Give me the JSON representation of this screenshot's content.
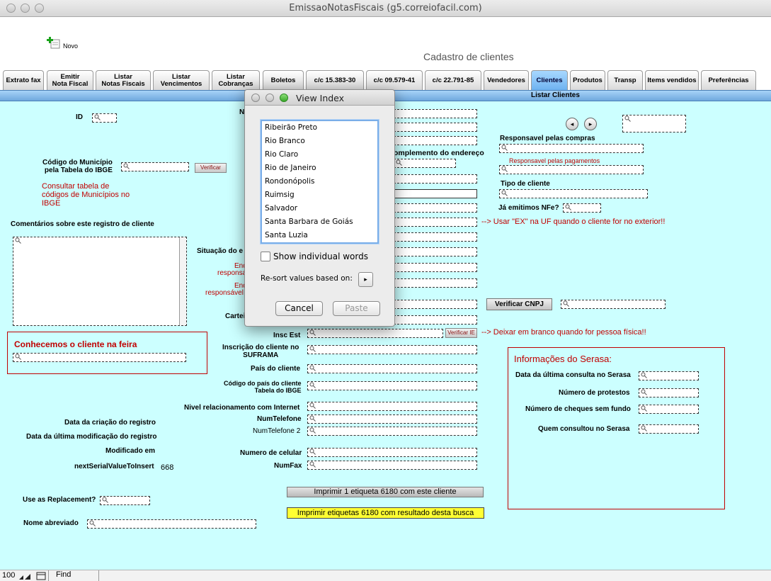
{
  "window": {
    "title": "EmissaoNotasFiscais (g5.correiofacil.com)"
  },
  "toolbar": {
    "new_label": "Novo",
    "page_heading": "Cadastro de clientes"
  },
  "tabs": [
    {
      "label": "Extrato fax"
    },
    {
      "label": "Emitir\nNota Fiscal"
    },
    {
      "label": "Listar\nNotas Fiscais"
    },
    {
      "label": "Listar\nVencimentos"
    },
    {
      "label": "Listar\nCobranças"
    },
    {
      "label": "Boletos"
    },
    {
      "label": "c/c 15.383-30"
    },
    {
      "label": "c/c 09.579-41"
    },
    {
      "label": "c/c 22.791-85"
    },
    {
      "label": "Vendedores"
    },
    {
      "label": "Clientes"
    },
    {
      "label": "Produtos"
    },
    {
      "label": "Transp"
    },
    {
      "label": "Items vendidos"
    },
    {
      "label": "Preferências"
    }
  ],
  "band": {
    "label": "Listar Clientes"
  },
  "form": {
    "id": "ID",
    "n_partial": "N",
    "codigo_municipio": "Código do Município\npela Tabela do IBGE",
    "verificar": "Verificar",
    "consultar_tabela": "Consultar tabela de\ncódigos de Municípios no\nIBGE",
    "comentarios": "Comentários sobre este registro de cliente",
    "situacao": "Situação do e",
    "en1": "End",
    "responsa1": "responsá",
    "en2": "End",
    "responsavel2": "responsável",
    "cartei": "Cartei",
    "conhecemos": "Conhecemos o cliente na feira",
    "insc_est": "Insc Est",
    "verificar_ie": "Verificar IE",
    "suframa": "Inscrição do cliente no\nSUFRAMA",
    "pais": "País do cliente",
    "codigo_pais": "Código do país do cliente\nTabela do IBGE",
    "nivel": "Nivel relacionamento com Internet",
    "numtelefone": "NumTelefone",
    "numtelefone2": "NumTelefone 2",
    "numero_celular": "Numero de celular",
    "numfax": "NumFax",
    "data_criacao": "Data da criação do registro",
    "data_modificacao": "Data da última modificação do registro",
    "modificado_em": "Modificado em",
    "next_serial_label": "nextSerialValueToInsert",
    "next_serial_value": "668",
    "use_replacement": "Use as Replacement?",
    "nome_abreviado": "Nome abreviado",
    "complemento": "omplemento do endereço",
    "uf_note": "--> Usar \"EX\" na UF quando o cliente for no exterior!!",
    "ie_note": "--> Deixar em branco quando for pessoa física!!",
    "verificar_cnpj": "Verificar CNPJ",
    "resp_compras": "Responsavel pelas compras",
    "resp_pagamentos": "Responsavel pelas pagamentos",
    "tipo_cliente": "Tipo de cliente",
    "ja_emitimos": "Já emitimos NFe?",
    "imprimir1": "Imprimir 1 etiqueta 6180 com este cliente",
    "imprimir2": "Imprimir etiquetas 6180 com resultado desta busca"
  },
  "serasa": {
    "title": "Informações do Serasa:",
    "ultima_consulta": "Data da última consulta no Serasa",
    "protestos": "Número de protestos",
    "cheques": "Número de cheques sem fundo",
    "quem": "Quem consultou no Serasa"
  },
  "dialog": {
    "title": "View Index",
    "items": [
      "Ribeirão Preto",
      "Rio Branco",
      "Rio Claro",
      "Rio de Janeiro",
      "Rondonópolis",
      "Ruimsig",
      "Salvador",
      "Santa Barbara de Goiás",
      "Santa Luzia"
    ],
    "show_words": "Show individual words",
    "resort": "Re-sort values based on:",
    "cancel": "Cancel",
    "paste": "Paste"
  },
  "statusbar": {
    "zoom": "100",
    "mode": "Find"
  },
  "colors": {
    "content_bg": "#ccffff",
    "accent_red": "#c00000",
    "highlight_yellow": "#ffff33",
    "active_tab": "#6eb2f0"
  }
}
